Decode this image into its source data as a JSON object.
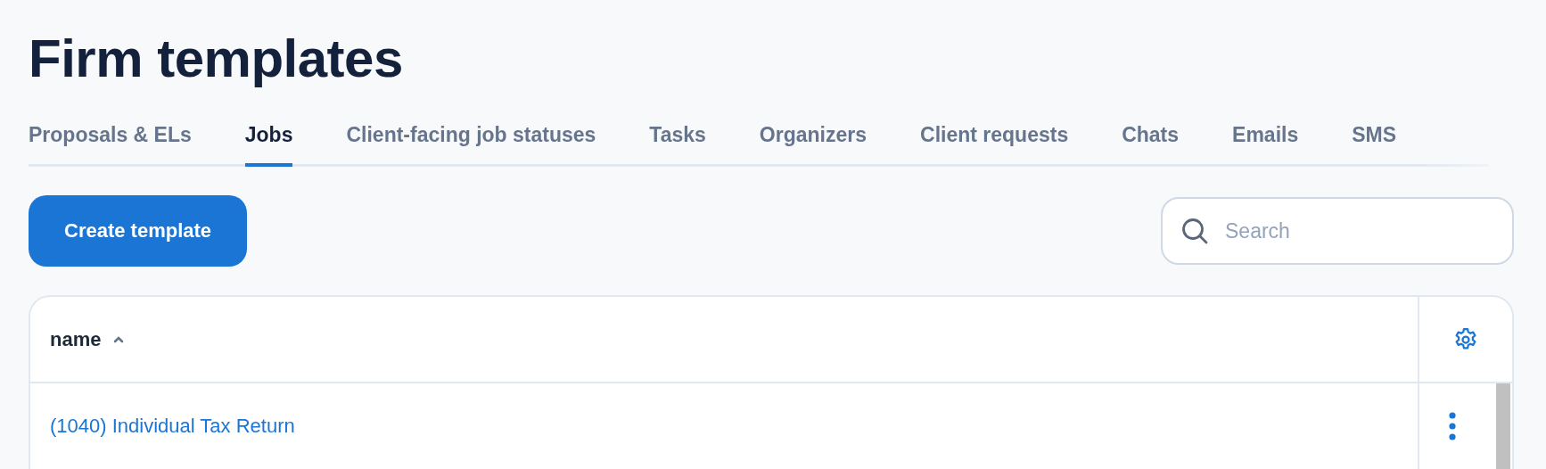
{
  "page": {
    "title": "Firm templates"
  },
  "tabs": [
    {
      "label": "Proposals & ELs",
      "selected": false
    },
    {
      "label": "Jobs",
      "selected": true
    },
    {
      "label": "Client-facing job statuses",
      "selected": false
    },
    {
      "label": "Tasks",
      "selected": false
    },
    {
      "label": "Organizers",
      "selected": false
    },
    {
      "label": "Client requests",
      "selected": false
    },
    {
      "label": "Chats",
      "selected": false
    },
    {
      "label": "Emails",
      "selected": false
    },
    {
      "label": "SMS",
      "selected": false
    }
  ],
  "toolbar": {
    "create_button": "Create template",
    "search": {
      "placeholder": "Search"
    }
  },
  "table": {
    "columns": [
      {
        "label": "name",
        "sort_ascending": true
      }
    ],
    "rows": [
      {
        "name": "(1040) Individual Tax Return"
      }
    ]
  }
}
